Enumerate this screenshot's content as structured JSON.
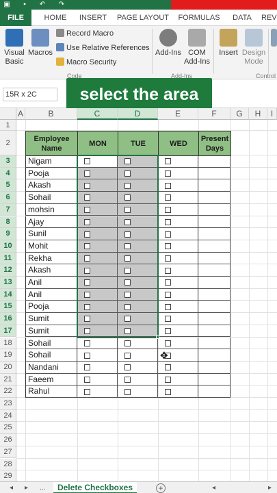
{
  "ribbon": {
    "tabs": [
      "FILE",
      "HOME",
      "INSERT",
      "PAGE LAYOUT",
      "FORMULAS",
      "DATA",
      "REV"
    ],
    "visual_basic": [
      "Visual",
      "Basic"
    ],
    "macros": "Macros",
    "record_macro": "Record Macro",
    "relative_refs": "Use Relative References",
    "macro_security": "Macro Security",
    "code_group": "Code",
    "addins": "Add-Ins",
    "com_addins": [
      "COM",
      "Add-Ins"
    ],
    "addins_group": "Add-Ins",
    "insert": "Insert",
    "design_mode": [
      "Design",
      "Mode"
    ],
    "controls_group": "Control"
  },
  "formula_bar": {
    "name_box": "15R x 2C"
  },
  "overlay": {
    "text": "select the area"
  },
  "columns": [
    "A",
    "B",
    "C",
    "D",
    "E",
    "F",
    "G",
    "H",
    "I"
  ],
  "rows": [
    "1",
    "2",
    "3",
    "4",
    "5",
    "6",
    "7",
    "8",
    "9",
    "10",
    "11",
    "12",
    "13",
    "14",
    "15",
    "16",
    "17",
    "18",
    "19",
    "20",
    "21",
    "22",
    "23",
    "24",
    "25",
    "26",
    "27",
    "28",
    "29"
  ],
  "table": {
    "headers": [
      "Employee Name",
      "MON",
      "TUE",
      "WED",
      "Present Days"
    ],
    "names": [
      "Nigam",
      "Pooja",
      "Akash",
      "Sohail",
      "mohsin",
      "Ajay",
      "Sunil",
      "Mohit",
      "Rekha",
      "Akash",
      "Anil",
      "Anil",
      "Pooja",
      "Sumit",
      "Sumit",
      "Sohail",
      "Sohail",
      "Nandani",
      "Faeem",
      "Rahul"
    ]
  },
  "sheet": {
    "nav_dots": "...",
    "active_tab": "Delete Checkboxes",
    "add": "+"
  },
  "colors": {
    "excel_green": "#217346",
    "header_fill": "#8fbf84",
    "selection_fill": "#c8c8c8",
    "overlay_bg": "#1e7b3c",
    "banner_red": "#e21c1c"
  }
}
